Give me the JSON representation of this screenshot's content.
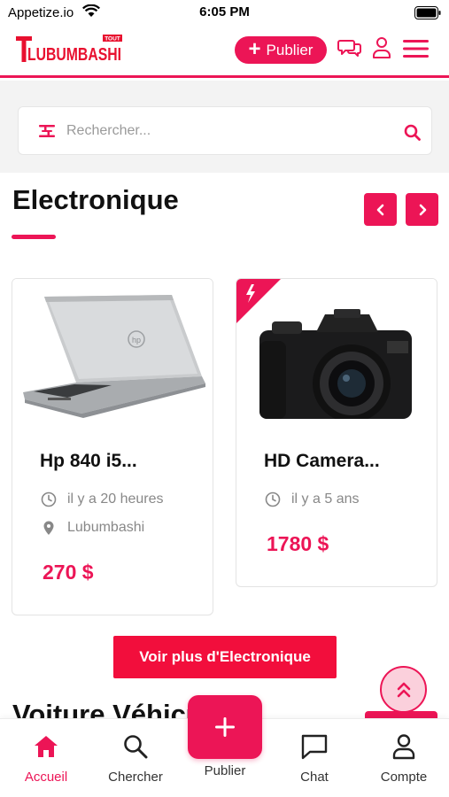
{
  "status_bar": {
    "carrier": "Appetize.io",
    "time": "6:05 PM"
  },
  "header": {
    "logo_small": "TOUT",
    "logo_main": "LUBUMBASHI",
    "publish_label": "Publier"
  },
  "search": {
    "placeholder": "Rechercher..."
  },
  "section": {
    "title": "Electronique",
    "more_label": "Voir plus d'Electronique"
  },
  "products": [
    {
      "name": "Hp 840 i5...",
      "time": "il y a 20 heures",
      "location": "Lubumbashi",
      "price": "270 $",
      "image": "laptop"
    },
    {
      "name": "HD Camera...",
      "time": "il y a 5 ans",
      "price": "1780 $",
      "image": "camera",
      "badge": "flash"
    }
  ],
  "next_section": {
    "title": "Voiture Véhicules"
  },
  "tabbar": {
    "items": [
      {
        "label": "Accueil",
        "icon": "home-icon",
        "active": true
      },
      {
        "label": "Chercher",
        "icon": "search-icon"
      },
      {
        "label": "Publier",
        "icon": "plus-icon"
      },
      {
        "label": "Chat",
        "icon": "chat-icon"
      },
      {
        "label": "Compte",
        "icon": "account-icon"
      }
    ]
  },
  "colors": {
    "accent": "#ec1556",
    "button_red": "#f20e3c"
  }
}
